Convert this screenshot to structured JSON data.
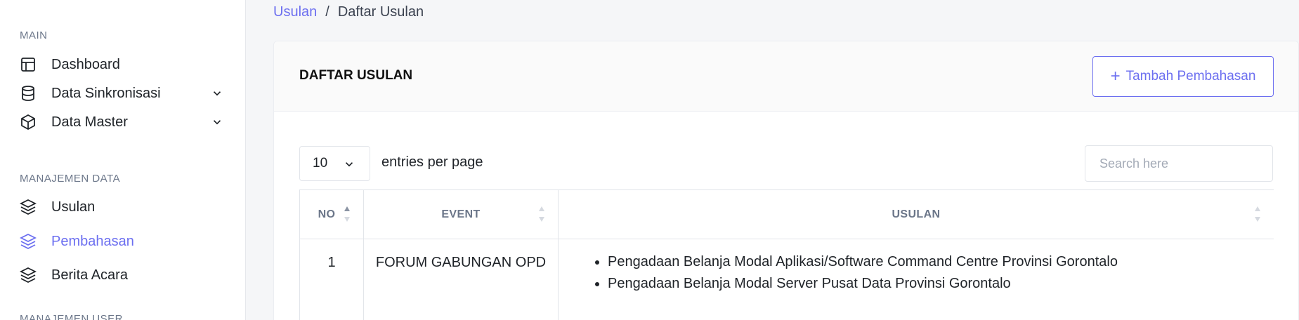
{
  "sidebar": {
    "sections": {
      "main": "MAIN",
      "manajemen_data": "MANAJEMEN DATA",
      "manajemen_user": "MANAJEMEN USER"
    },
    "items": [
      {
        "label": "Dashboard",
        "icon": "layout-icon"
      },
      {
        "label": "Data Sinkronisasi",
        "icon": "database-icon",
        "expandable": true
      },
      {
        "label": "Data Master",
        "icon": "box-icon",
        "expandable": true
      },
      {
        "label": "Usulan",
        "icon": "layers-icon"
      },
      {
        "label": "Pembahasan",
        "icon": "layers-icon",
        "active": true
      },
      {
        "label": "Berita Acara",
        "icon": "layers-icon"
      }
    ]
  },
  "breadcrumb": {
    "parent": "Usulan",
    "separator": "/",
    "current": "Daftar Usulan"
  },
  "card": {
    "title": "DAFTAR USULAN",
    "add_button": {
      "icon": "+",
      "label": "Tambah Pembahasan"
    }
  },
  "table_controls": {
    "entries_value": "10",
    "entries_label": "entries per page",
    "search_placeholder": "Search here"
  },
  "table": {
    "headers": {
      "no": "NO",
      "event": "EVENT",
      "usulan": "USULAN"
    },
    "rows": [
      {
        "no": "1",
        "event": "FORUM GABUNGAN OPD",
        "usulan": [
          "Pengadaan Belanja Modal Aplikasi/Software Command Centre Provinsi Gorontalo",
          "Pengadaan Belanja Modal Server Pusat Data Provinsi Gorontalo"
        ]
      }
    ]
  },
  "colors": {
    "accent": "#6c6ff0",
    "muted": "#6b7689",
    "border": "#e2e5ea"
  }
}
